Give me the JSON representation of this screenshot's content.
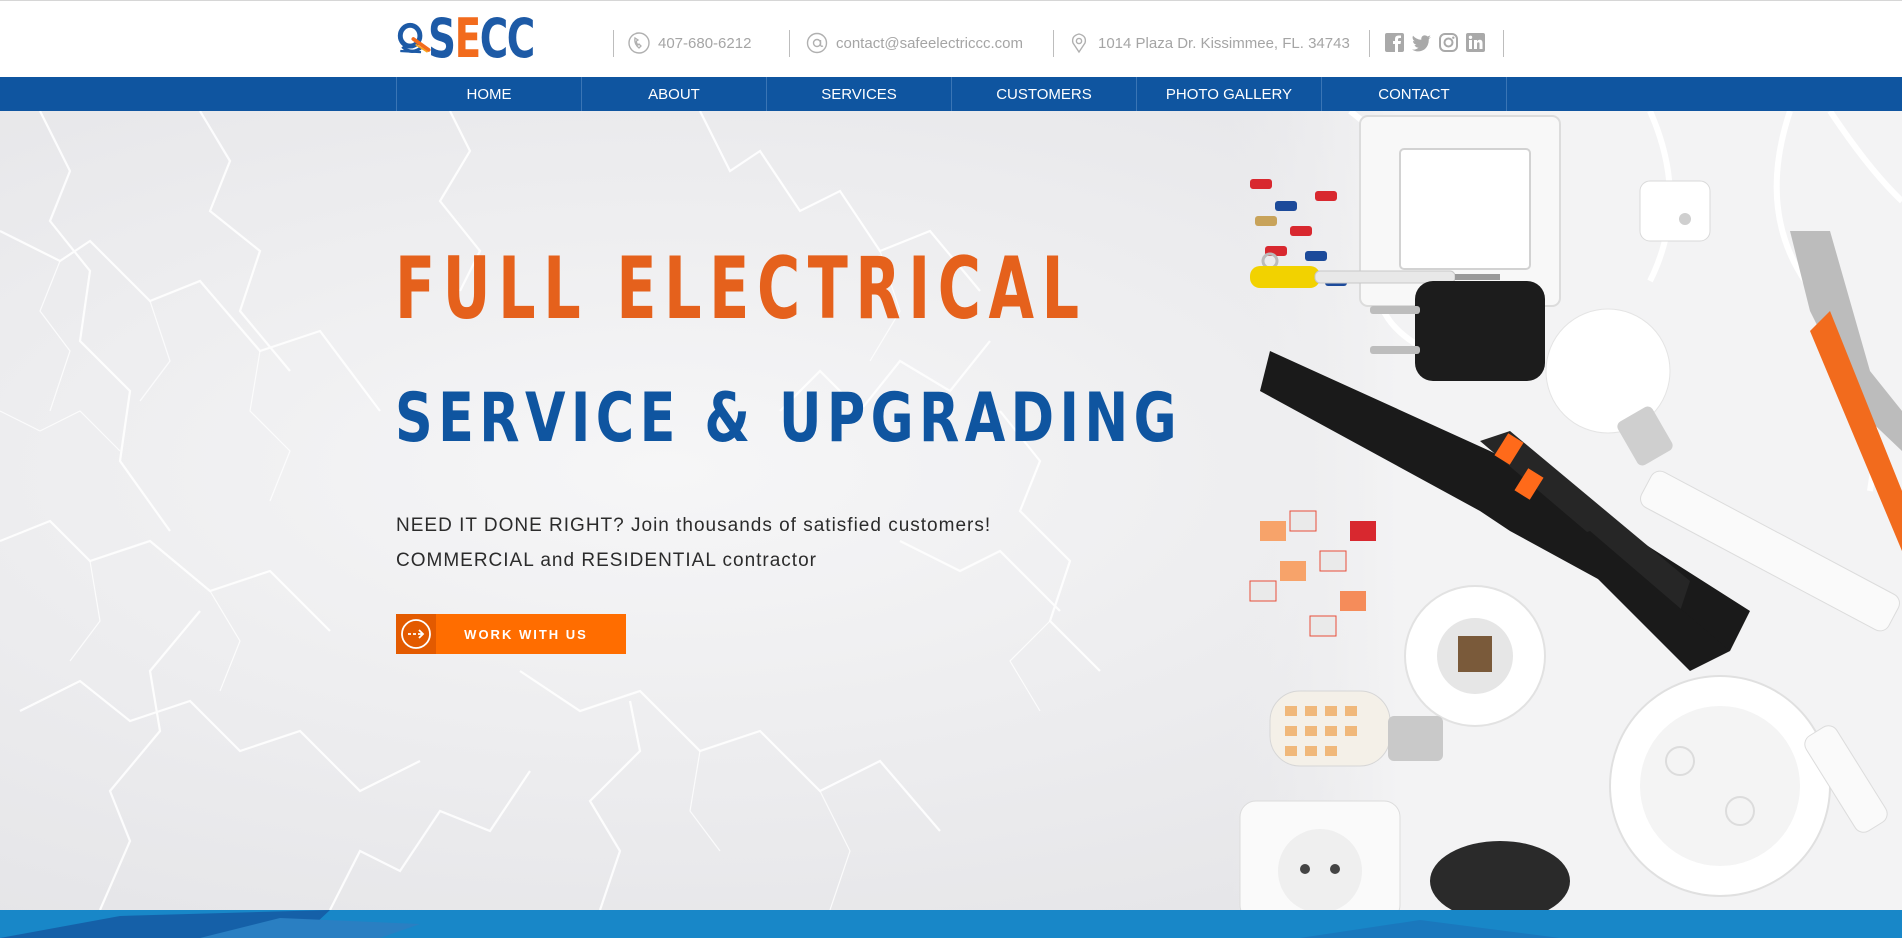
{
  "header": {
    "logo_text_1": "S",
    "logo_text_e": "E",
    "logo_text_2": "CC",
    "phone": "407-680-6212",
    "email": "contact@safeelectriccc.com",
    "address": "1014 Plaza Dr. Kissimmee, FL. 34743",
    "social": [
      "facebook-icon",
      "twitter-icon",
      "instagram-icon",
      "linkedin-icon"
    ]
  },
  "nav": {
    "items": [
      "HOME",
      "ABOUT",
      "SERVICES",
      "CUSTOMERS",
      "PHOTO GALLERY",
      "CONTACT"
    ]
  },
  "hero": {
    "headline_1": "FULL ELECTRICAL",
    "headline_2": "SERVICE & UPGRADING",
    "sub_1": "NEED IT DONE RIGHT? Join thousands of satisfied customers!",
    "sub_2": "COMMERCIAL and RESIDENTIAL contractor",
    "cta_label": "WORK WITH US"
  },
  "colors": {
    "brand_blue": "#0f55a0",
    "brand_orange": "#e5611c",
    "cta_orange": "#ff6d00",
    "strip_blue": "#1887c8"
  }
}
